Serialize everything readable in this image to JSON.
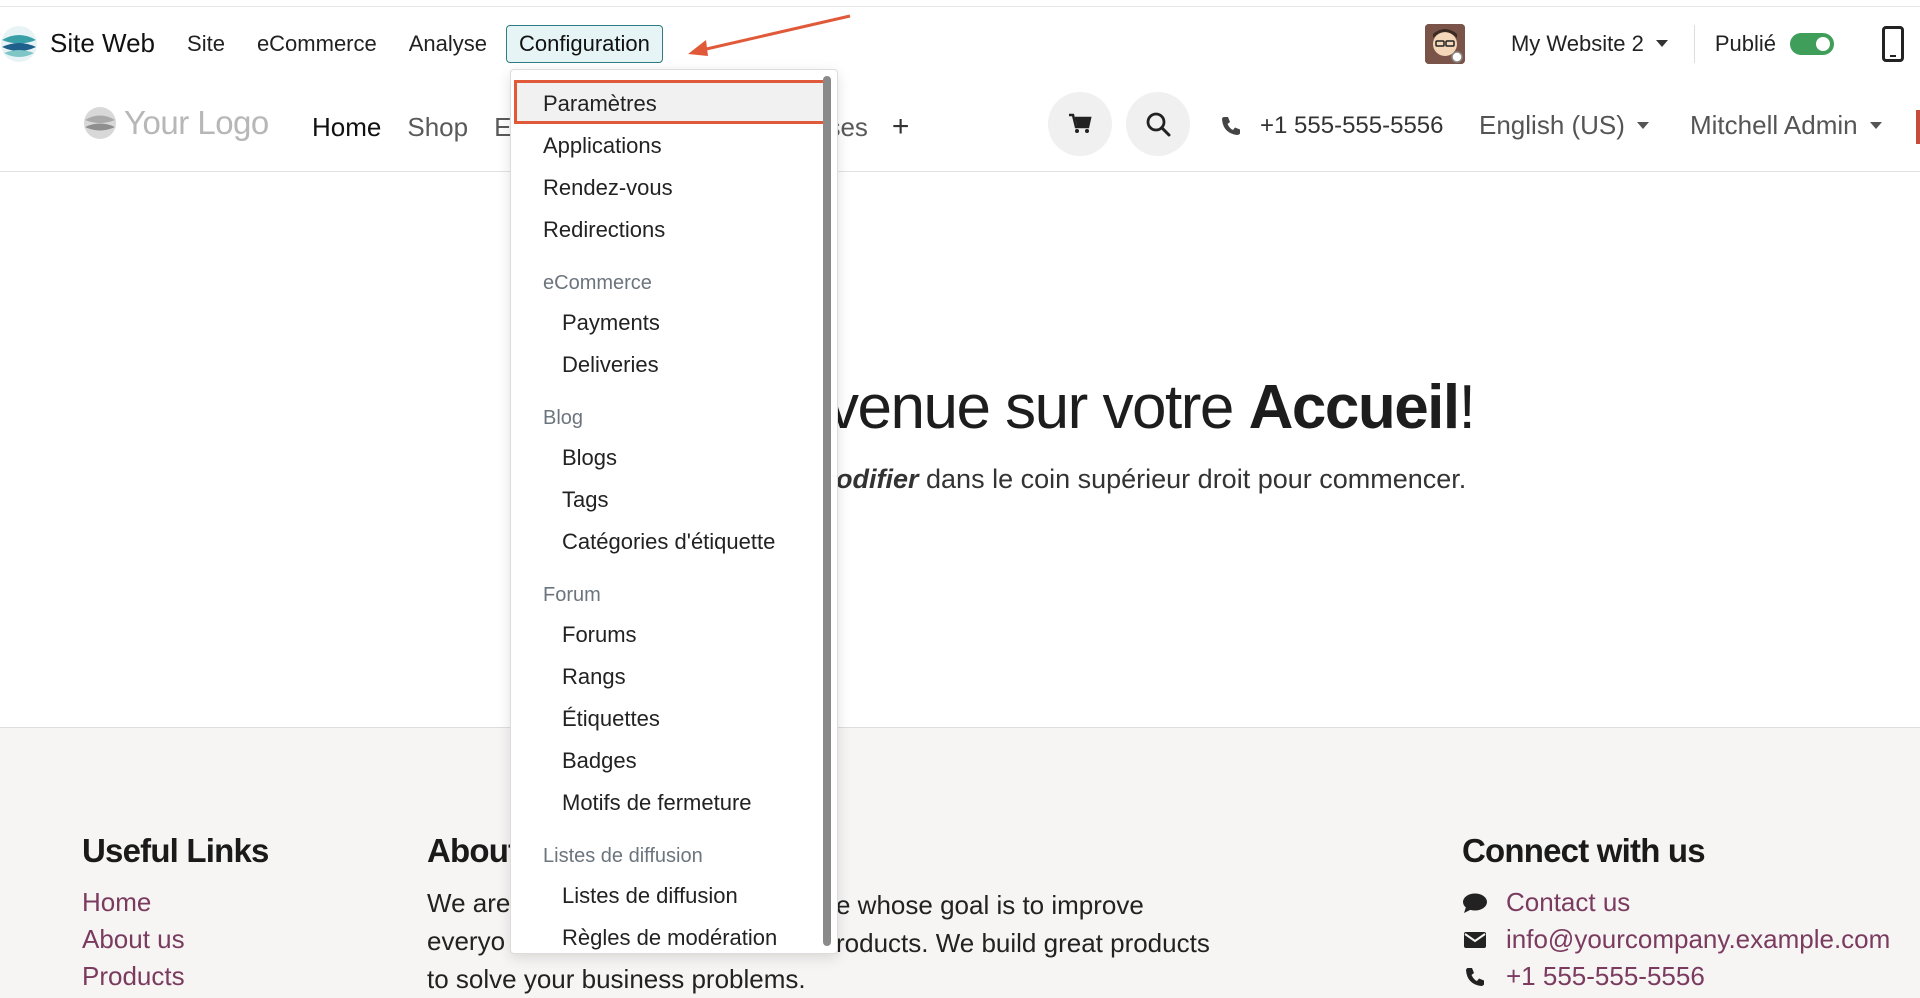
{
  "topbar": {
    "brand": "Site Web",
    "menu": [
      "Site",
      "eCommerce",
      "Analyse"
    ],
    "active_menu": "Configuration",
    "website": "My Website 2",
    "publish_label": "Publié"
  },
  "site_header": {
    "logo_text": "Your Logo",
    "nav": [
      "Home",
      "Shop",
      "E",
      "ses"
    ],
    "plus": "+",
    "phone": "+1 555-555-5556",
    "language": "English (US)",
    "user": "Mitchell Admin"
  },
  "hero": {
    "title_prefix": "venue sur votre ",
    "title_bold": "Accueil",
    "title_suffix": "!",
    "subtitle_bold": "odifier",
    "subtitle_rest": " dans le coin supérieur droit pour commencer."
  },
  "dropdown": {
    "items": [
      "Paramètres",
      "Applications",
      "Rendez-vous",
      "Redirections"
    ],
    "ecommerce_header": "eCommerce",
    "ecommerce_items": [
      "Payments",
      "Deliveries"
    ],
    "blog_header": "Blog",
    "blog_items": [
      "Blogs",
      "Tags",
      "Catégories d'étiquette"
    ],
    "forum_header": "Forum",
    "forum_items": [
      "Forums",
      "Rangs",
      "Étiquettes",
      "Badges",
      "Motifs de fermeture"
    ],
    "lists_header": "Listes de diffusion",
    "lists_items": [
      "Listes de diffusion",
      "Règles de modération"
    ]
  },
  "footer": {
    "useful_title": "Useful Links",
    "useful_links": [
      "Home",
      "About us",
      "Products"
    ],
    "about_title": "About",
    "about_lines": [
      "We are",
      "everyo",
      "to solve your business problems."
    ],
    "about_lines_right": [
      "e whose goal is to improve",
      "roducts. We build great products"
    ],
    "connect_title": "Connect with us",
    "contact_items": [
      "Contact us",
      "info@yourcompany.example.com",
      "+1 555-555-5556"
    ]
  },
  "colors": {
    "accent_teal": "#2d7d85",
    "highlight_red": "#e05a3a",
    "link_purple": "#7a3b5f",
    "toggle_green": "#3f9e5a"
  }
}
